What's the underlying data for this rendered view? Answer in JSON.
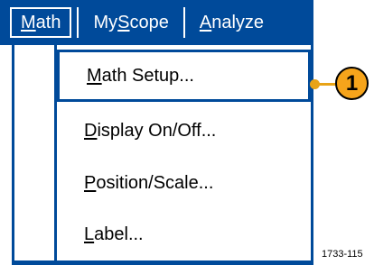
{
  "menubar": {
    "items": [
      {
        "pre": "",
        "ul": "M",
        "post": "ath",
        "active": true
      },
      {
        "pre": "My",
        "ul": "S",
        "post": "cope",
        "active": false
      },
      {
        "pre": "",
        "ul": "A",
        "post": "nalyze",
        "active": false
      }
    ]
  },
  "dropdown": {
    "items": [
      {
        "ul": "M",
        "rest": "ath Setup..."
      },
      {
        "ul": "D",
        "rest": "isplay On/Off..."
      },
      {
        "ul": "P",
        "rest": "osition/Scale..."
      },
      {
        "ul": "L",
        "rest": "abel..."
      }
    ]
  },
  "callout": {
    "number": "1"
  },
  "figure_id": "1733-115",
  "colors": {
    "menu_blue": "#004a9a",
    "callout_orange": "#f6a41b"
  }
}
